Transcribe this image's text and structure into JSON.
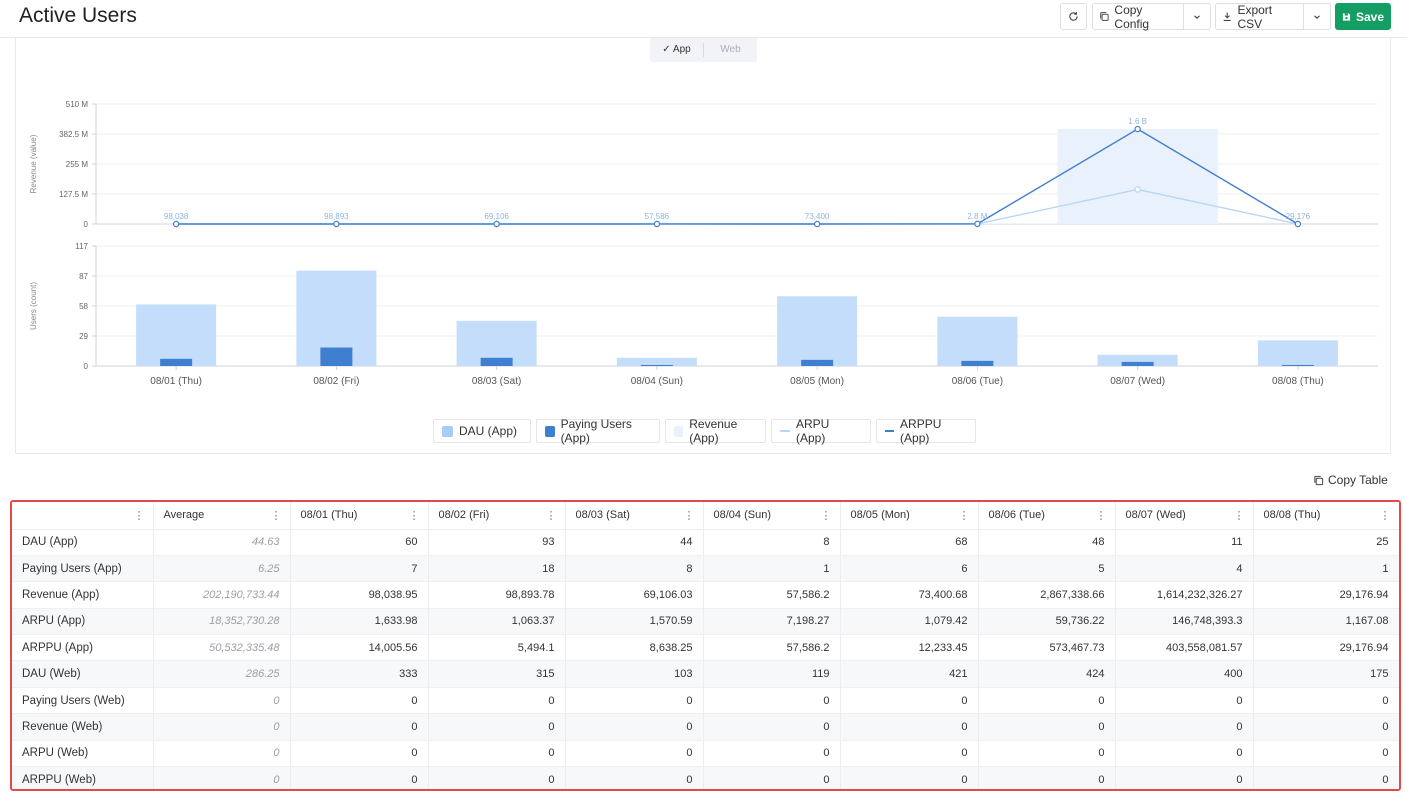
{
  "page": {
    "title": "Active Users"
  },
  "toolbar": {
    "refresh_icon": "refresh-icon",
    "copy_config_label": "Copy Config",
    "export_csv_label": "Export CSV",
    "save_label": "Save"
  },
  "platform_toggle": {
    "app_label": "✓ App",
    "web_label": "Web",
    "selected": "App"
  },
  "copy_table_label": "Copy Table",
  "legend": [
    {
      "label": "DAU (App)",
      "kind": "swatch",
      "color": "#a7cdf5"
    },
    {
      "label": "Paying Users (App)",
      "kind": "swatch",
      "color": "#3f7fcf"
    },
    {
      "label": "Revenue (App)",
      "kind": "swatch",
      "color": "#e8f1fc"
    },
    {
      "label": "ARPU (App)",
      "kind": "line",
      "color": "#b9d6f3"
    },
    {
      "label": "ARPPU (App)",
      "kind": "line",
      "color": "#3f7fcf"
    }
  ],
  "chart_data": [
    {
      "type": "line",
      "ylabel": "Revenue (value)",
      "yticks": [
        "510 M",
        "382.5 M",
        "255 M",
        "127.5 M",
        "0"
      ],
      "ylim": [
        0,
        510000000
      ],
      "grid": true,
      "categories": [
        "08/01 (Thu)",
        "08/02 (Fri)",
        "08/03 (Sat)",
        "08/04 (Sun)",
        "08/05 (Mon)",
        "08/06 (Tue)",
        "08/07 (Wed)",
        "08/08 (Thu)"
      ],
      "series": [
        {
          "name": "Revenue (App)",
          "style": "bar",
          "color": "#e8f1fc",
          "values": [
            98038.95,
            98893.78,
            69106.03,
            57586.2,
            73400.68,
            2867338.66,
            403558081.57,
            29176.94
          ]
        },
        {
          "name": "ARPU (App)",
          "style": "line",
          "color": "#b9d6f3",
          "values": [
            1633.98,
            1063.37,
            1570.59,
            7198.27,
            1079.42,
            59736.22,
            146748393.3,
            1167.08
          ]
        },
        {
          "name": "ARPPU (App)",
          "style": "line",
          "color": "#3f7fcf",
          "values": [
            14005.56,
            5494.1,
            8638.25,
            57586.2,
            12233.45,
            573467.73,
            403558081.57,
            29176.94
          ]
        }
      ],
      "data_labels": [
        "98,038",
        "98,893",
        "69,106",
        "57,586",
        "73,400",
        "2.8 M",
        "1.6 B",
        "29,176"
      ]
    },
    {
      "type": "bar",
      "ylabel": "Users (count)",
      "yticks": [
        "117",
        "87",
        "58",
        "29",
        "0"
      ],
      "ylim": [
        0,
        117
      ],
      "grid": true,
      "categories": [
        "08/01 (Thu)",
        "08/02 (Fri)",
        "08/03 (Sat)",
        "08/04 (Sun)",
        "08/05 (Mon)",
        "08/06 (Tue)",
        "08/07 (Wed)",
        "08/08 (Thu)"
      ],
      "series": [
        {
          "name": "DAU (App)",
          "color": "#c3ddfa",
          "values": [
            60,
            93,
            44,
            8,
            68,
            48,
            11,
            25
          ]
        },
        {
          "name": "Paying Users (App)",
          "color": "#3f7fcf",
          "values": [
            7,
            18,
            8,
            1,
            6,
            5,
            4,
            1
          ]
        }
      ]
    }
  ],
  "table": {
    "headers": [
      "",
      "Average",
      "08/01 (Thu)",
      "08/02 (Fri)",
      "08/03 (Sat)",
      "08/04 (Sun)",
      "08/05 (Mon)",
      "08/06 (Tue)",
      "08/07 (Wed)",
      "08/08 (Thu)"
    ],
    "rows": [
      [
        "DAU (App)",
        "44.63",
        "60",
        "93",
        "44",
        "8",
        "68",
        "48",
        "11",
        "25"
      ],
      [
        "Paying Users (App)",
        "6.25",
        "7",
        "18",
        "8",
        "1",
        "6",
        "5",
        "4",
        "1"
      ],
      [
        "Revenue (App)",
        "202,190,733.44",
        "98,038.95",
        "98,893.78",
        "69,106.03",
        "57,586.2",
        "73,400.68",
        "2,867,338.66",
        "1,614,232,326.27",
        "29,176.94"
      ],
      [
        "ARPU (App)",
        "18,352,730.28",
        "1,633.98",
        "1,063.37",
        "1,570.59",
        "7,198.27",
        "1,079.42",
        "59,736.22",
        "146,748,393.3",
        "1,167.08"
      ],
      [
        "ARPPU (App)",
        "50,532,335.48",
        "14,005.56",
        "5,494.1",
        "8,638.25",
        "57,586.2",
        "12,233.45",
        "573,467.73",
        "403,558,081.57",
        "29,176.94"
      ],
      [
        "DAU (Web)",
        "286.25",
        "333",
        "315",
        "103",
        "119",
        "421",
        "424",
        "400",
        "175"
      ],
      [
        "Paying Users (Web)",
        "0",
        "0",
        "0",
        "0",
        "0",
        "0",
        "0",
        "0",
        "0"
      ],
      [
        "Revenue (Web)",
        "0",
        "0",
        "0",
        "0",
        "0",
        "0",
        "0",
        "0",
        "0"
      ],
      [
        "ARPU (Web)",
        "0",
        "0",
        "0",
        "0",
        "0",
        "0",
        "0",
        "0",
        "0"
      ],
      [
        "ARPPU (Web)",
        "0",
        "0",
        "0",
        "0",
        "0",
        "0",
        "0",
        "0",
        "0"
      ]
    ]
  }
}
